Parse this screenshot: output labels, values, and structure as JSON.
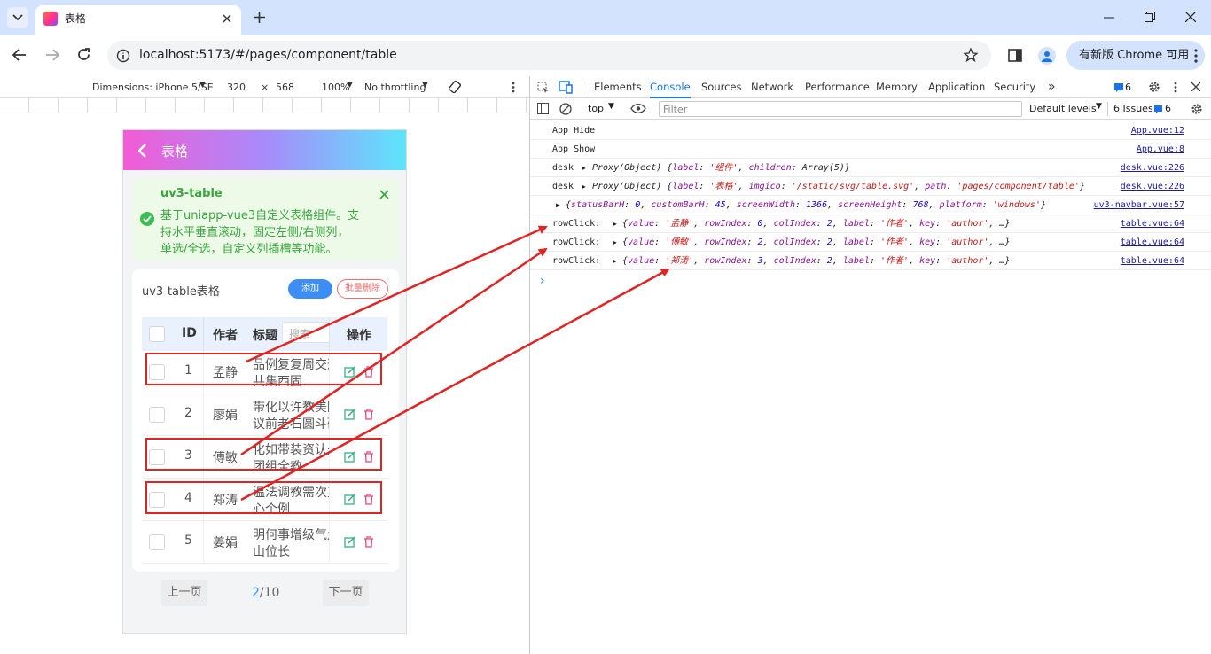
{
  "browser": {
    "tab_title": "表格",
    "url": "localhost:5173/#/pages/component/table",
    "chrome_update_label": "有新版 Chrome 可用"
  },
  "device_toolbar": {
    "dimensions_label": "Dimensions: iPhone 5/SE",
    "width": "320",
    "times": "×",
    "height": "568",
    "zoom": "100%",
    "throttle": "No throttling"
  },
  "devtools": {
    "tabs": [
      "Elements",
      "Console",
      "Sources",
      "Network",
      "Performance",
      "Memory",
      "Application",
      "Security"
    ],
    "more": "»",
    "issues_count": "6",
    "context": "top",
    "filter_placeholder": "Filter",
    "levels": "Default levels",
    "issues_label": "6 Issues:",
    "issues_badge": "6",
    "logs": [
      {
        "prefix": "App Hide",
        "source": "App.vue:12"
      },
      {
        "prefix": "App Show",
        "source": "App.vue:8"
      },
      {
        "prefix": "desk",
        "source": "desk.vue:226"
      },
      {
        "prefix": "desk",
        "source": "desk.vue:226"
      },
      {
        "prefix": "",
        "source": "uv3-navbar.vue:57"
      },
      {
        "prefix": "rowClick:",
        "source": "table.vue:64"
      },
      {
        "prefix": "rowClick:",
        "source": "table.vue:64"
      },
      {
        "prefix": "rowClick:",
        "source": "table.vue:64"
      }
    ],
    "log3": {
      "a": "Proxy(Object) {",
      "k1": "label",
      "v1": "'组件'",
      "k2": "children",
      "v2": "Array(5)",
      "end": "}"
    },
    "log4": {
      "a": "Proxy(Object) {",
      "k1": "label",
      "v1": "'表格'",
      "k2": "imgico",
      "v2": "'/static/svg/table.svg'",
      "k3": "path",
      "v3": "'pages/component/table'",
      "end": "}"
    },
    "log5": {
      "a": "{",
      "k1": "statusBarH",
      "v1": "0",
      "k2": "customBarH",
      "v2": "45",
      "k3": "screenWidth",
      "v3": "1366",
      "k4": "screenHeight",
      "v4": "768",
      "k5": "platform",
      "v5": "'windows'",
      "end": "}"
    },
    "rowclicks": [
      {
        "value": "'孟静'",
        "rowIndex": "0"
      },
      {
        "value": "'傅敏'",
        "rowIndex": "2"
      },
      {
        "value": "'郑涛'",
        "rowIndex": "3"
      }
    ],
    "rc": {
      "k_value": "value",
      "k_rowIndex": "rowIndex",
      "k_colIndex": "colIndex",
      "colIndex": "2",
      "k_label": "label",
      "label": "'作者'",
      "k_key": "key",
      "key": "'author'",
      "end": "…}"
    },
    "prompt": "›"
  },
  "app": {
    "navbar_title": "表格",
    "alert": {
      "title": "uv3-table",
      "line1": "基于uniapp-vue3自定义表格组件。支",
      "line2": "持水平垂直滚动，固定左侧/右侧列，",
      "line3": "单选/全选，自定义列插槽等功能。"
    },
    "card_title": "uv3-table表格",
    "add_label": "添加",
    "batch_delete_label": "批量删除",
    "columns": {
      "id": "ID",
      "author": "作者",
      "title": "标题",
      "search_placeholder": "搜索",
      "action": "操作"
    },
    "rows": [
      {
        "id": "1",
        "author": "孟静",
        "title1": "品例复复周交通",
        "title2": "共集西固"
      },
      {
        "id": "2",
        "author": "廖娟",
        "title1": "带化以许教美阿",
        "title2": "议前老石圆斗码"
      },
      {
        "id": "3",
        "author": "傅敏",
        "title1": "化如带装资认是",
        "title2": "团组全教"
      },
      {
        "id": "4",
        "author": "郑涛",
        "title1": "温法调教需次其",
        "title2": "心个例"
      },
      {
        "id": "5",
        "author": "姜娟",
        "title1": "明何事增级气走",
        "title2": "山位长"
      }
    ],
    "pager": {
      "prev": "上一页",
      "current": "2",
      "total": "/10",
      "next": "下一页"
    }
  }
}
